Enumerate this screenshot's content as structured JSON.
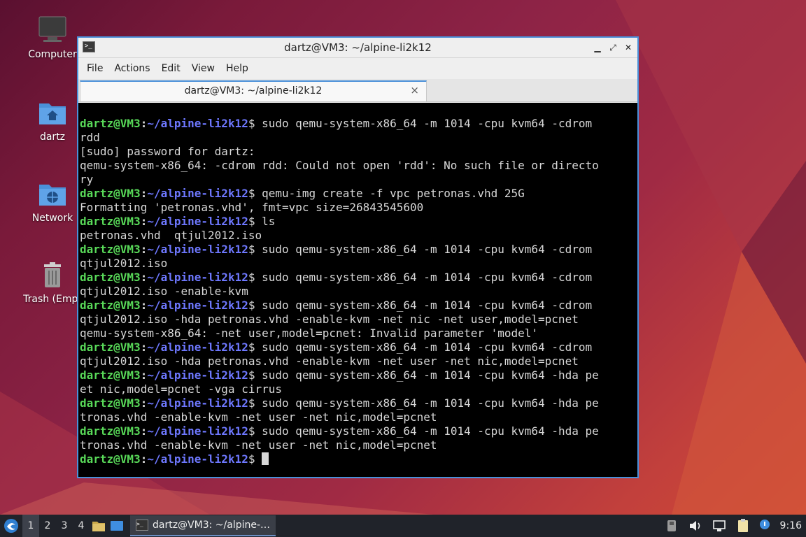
{
  "desktop": {
    "icons": [
      {
        "label": "Computer"
      },
      {
        "label": "dartz"
      },
      {
        "label": "Network"
      },
      {
        "label": "Trash (Empt"
      }
    ]
  },
  "window": {
    "title": "dartz@VM3: ~/alpine-li2k12",
    "menu": [
      "File",
      "Actions",
      "Edit",
      "View",
      "Help"
    ],
    "tab_title": "dartz@VM3: ~/alpine-li2k12",
    "tab_close": "×",
    "buttons": {
      "minimize": "▁",
      "maximize": "⤢",
      "close": "✕"
    }
  },
  "terminal": {
    "prompt": {
      "user": "dartz@VM3",
      "colon": ":",
      "path": "~/alpine-li2k12",
      "dollar": "$"
    },
    "lines": [
      {
        "p": true,
        "t": " sudo qemu-system-x86_64 -m 1014 -cpu kvm64 -cdrom"
      },
      {
        "p": false,
        "t": "rdd"
      },
      {
        "p": false,
        "t": "[sudo] password for dartz:"
      },
      {
        "p": false,
        "t": "qemu-system-x86_64: -cdrom rdd: Could not open 'rdd': No such file or directo"
      },
      {
        "p": false,
        "t": "ry"
      },
      {
        "p": true,
        "t": " qemu-img create -f vpc petronas.vhd 25G"
      },
      {
        "p": false,
        "t": "Formatting 'petronas.vhd', fmt=vpc size=26843545600"
      },
      {
        "p": true,
        "t": " ls"
      },
      {
        "p": false,
        "t": "petronas.vhd  qtjul2012.iso"
      },
      {
        "p": true,
        "t": " sudo qemu-system-x86_64 -m 1014 -cpu kvm64 -cdrom"
      },
      {
        "p": false,
        "t": "qtjul2012.iso"
      },
      {
        "p": true,
        "t": " sudo qemu-system-x86_64 -m 1014 -cpu kvm64 -cdrom"
      },
      {
        "p": false,
        "t": "qtjul2012.iso -enable-kvm"
      },
      {
        "p": true,
        "t": " sudo qemu-system-x86_64 -m 1014 -cpu kvm64 -cdrom"
      },
      {
        "p": false,
        "t": "qtjul2012.iso -hda petronas.vhd -enable-kvm -net nic -net user,model=pcnet"
      },
      {
        "p": false,
        "t": "qemu-system-x86_64: -net user,model=pcnet: Invalid parameter 'model'"
      },
      {
        "p": true,
        "t": " sudo qemu-system-x86_64 -m 1014 -cpu kvm64 -cdrom"
      },
      {
        "p": false,
        "t": "qtjul2012.iso -hda petronas.vhd -enable-kvm -net user -net nic,model=pcnet"
      },
      {
        "p": true,
        "t": " sudo qemu-system-x86_64 -m 1014 -cpu kvm64 -hda pe"
      },
      {
        "p": false,
        "t": "et nic,model=pcnet -vga cirrus"
      },
      {
        "p": true,
        "t": " sudo qemu-system-x86_64 -m 1014 -cpu kvm64 -hda pe"
      },
      {
        "p": false,
        "t": "tronas.vhd -enable-kvm -net user -net nic,model=pcnet"
      },
      {
        "p": true,
        "t": " sudo qemu-system-x86_64 -m 1014 -cpu kvm64 -hda pe"
      },
      {
        "p": false,
        "t": "tronas.vhd -enable-kvm -net user -net nic,model=pcnet"
      },
      {
        "p": true,
        "t": " ",
        "cursor": true
      }
    ]
  },
  "taskbar": {
    "workspaces": [
      "1",
      "2",
      "3",
      "4"
    ],
    "task_label": "dartz@VM3: ~/alpine-…",
    "clock": "9:16"
  },
  "colors": {
    "prompt_user": "#58d858",
    "prompt_path": "#6e78ff",
    "window_border": "#4a90d9",
    "taskbar": "#20232a"
  }
}
